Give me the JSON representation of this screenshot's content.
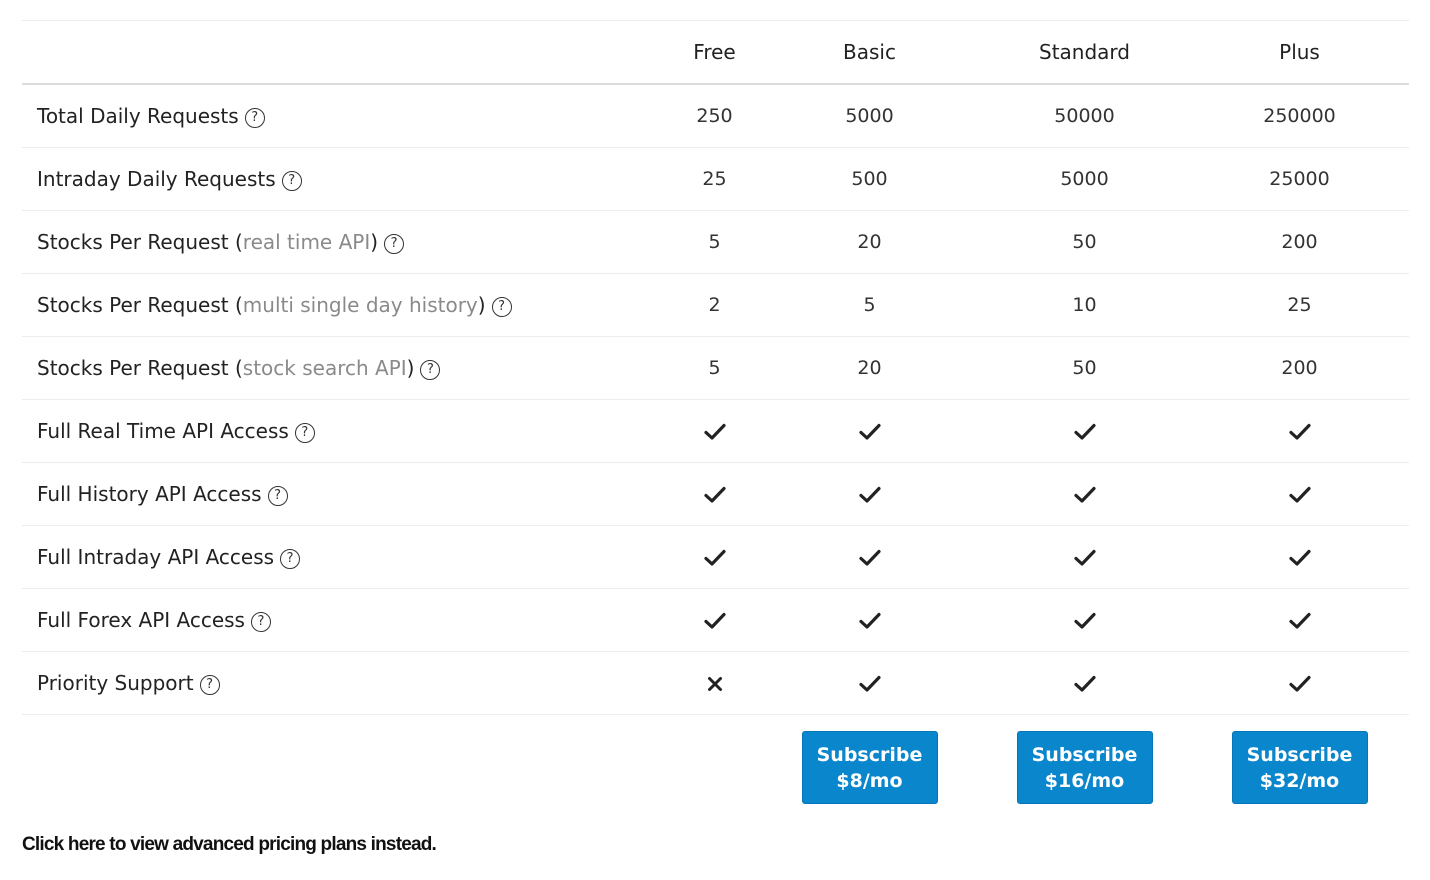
{
  "plans": [
    "Free",
    "Basic",
    "Standard",
    "Plus"
  ],
  "rows": [
    {
      "label": "Total Daily Requests",
      "paren": "",
      "values": [
        "250",
        "5000",
        "50000",
        "250000"
      ]
    },
    {
      "label": "Intraday Daily Requests",
      "paren": "",
      "values": [
        "25",
        "500",
        "5000",
        "25000"
      ]
    },
    {
      "label": "Stocks Per Request",
      "paren": "real time API",
      "values": [
        "5",
        "20",
        "50",
        "200"
      ]
    },
    {
      "label": "Stocks Per Request",
      "paren": "multi single day history",
      "values": [
        "2",
        "5",
        "10",
        "25"
      ]
    },
    {
      "label": "Stocks Per Request",
      "paren": "stock search API",
      "values": [
        "5",
        "20",
        "50",
        "200"
      ]
    },
    {
      "label": "Full Real Time API Access",
      "paren": "",
      "marks": [
        "check",
        "check",
        "check",
        "check"
      ]
    },
    {
      "label": "Full History API Access",
      "paren": "",
      "marks": [
        "check",
        "check",
        "check",
        "check"
      ]
    },
    {
      "label": "Full Intraday API Access",
      "paren": "",
      "marks": [
        "check",
        "check",
        "check",
        "check"
      ]
    },
    {
      "label": "Full Forex API Access",
      "paren": "",
      "marks": [
        "check",
        "check",
        "check",
        "check"
      ]
    },
    {
      "label": "Priority Support",
      "paren": "",
      "marks": [
        "cross",
        "check",
        "check",
        "check"
      ]
    }
  ],
  "help_icon": "question-circle-icon",
  "buttons": [
    {
      "plan": "Basic",
      "line1": "Subscribe",
      "line2": "$8/mo"
    },
    {
      "plan": "Standard",
      "line1": "Subscribe",
      "line2": "$16/mo"
    },
    {
      "plan": "Plus",
      "line1": "Subscribe",
      "line2": "$32/mo"
    }
  ],
  "colors": {
    "button": "#0a86cd",
    "muted": "#8a8a8a"
  },
  "advanced_link": "Click here to view advanced pricing plans instead."
}
